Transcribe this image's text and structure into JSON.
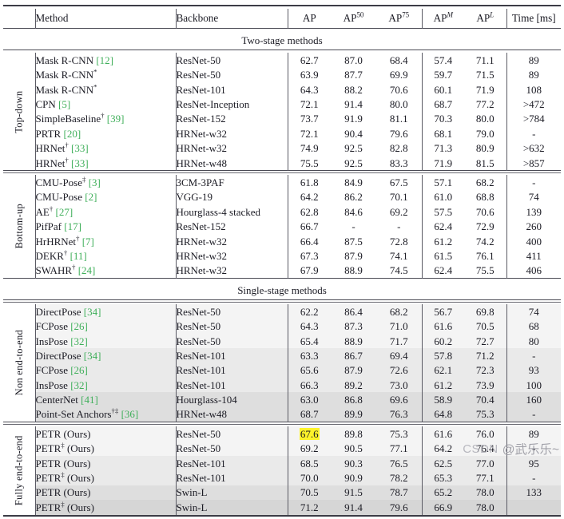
{
  "table": {
    "columns": [
      {
        "key": "group",
        "label": ""
      },
      {
        "key": "method",
        "label": "Method"
      },
      {
        "key": "backbone",
        "label": "Backbone"
      },
      {
        "key": "ap",
        "label": "AP"
      },
      {
        "key": "ap50",
        "label": "AP",
        "sup": "50"
      },
      {
        "key": "ap75",
        "label": "AP",
        "sup": "75"
      },
      {
        "key": "apm",
        "label": "AP",
        "sup": "M",
        "sup_italic": true
      },
      {
        "key": "apl",
        "label": "AP",
        "sup": "L",
        "sup_italic": true
      },
      {
        "key": "time",
        "label": "Time [ms]"
      }
    ],
    "banners": {
      "two_stage": "Two-stage methods",
      "single_stage": "Single-stage methods"
    },
    "groups": [
      {
        "label": "Top-down",
        "rows": [
          {
            "method": "Mask R-CNN",
            "cite": "12",
            "sup": "",
            "backbone": "ResNet-50",
            "ap": "62.7",
            "ap50": "87.0",
            "ap75": "68.4",
            "apm": "57.4",
            "apl": "71.1",
            "time": "89",
            "shade": "sh0"
          },
          {
            "method": "Mask R-CNN",
            "cite": "",
            "sup": "*",
            "backbone": "ResNet-50",
            "ap": "63.9",
            "ap50": "87.7",
            "ap75": "69.9",
            "apm": "59.7",
            "apl": "71.5",
            "time": "89",
            "shade": "sh0"
          },
          {
            "method": "Mask R-CNN",
            "cite": "",
            "sup": "*",
            "backbone": "ResNet-101",
            "ap": "64.3",
            "ap50": "88.2",
            "ap75": "70.6",
            "apm": "60.1",
            "apl": "71.9",
            "time": "108",
            "shade": "sh0"
          },
          {
            "method": "CPN",
            "cite": "5",
            "sup": "",
            "backbone": "ResNet-Inception",
            "ap": "72.1",
            "ap50": "91.4",
            "ap75": "80.0",
            "apm": "68.7",
            "apl": "77.2",
            "time": ">472",
            "shade": "sh0"
          },
          {
            "method": "SimpleBaseline",
            "cite": "39",
            "sup": "†",
            "backbone": "ResNet-152",
            "ap": "73.7",
            "ap50": "91.9",
            "ap75": "81.1",
            "apm": "70.3",
            "apl": "80.0",
            "time": ">784",
            "shade": "sh0"
          },
          {
            "method": "PRTR",
            "cite": "20",
            "sup": "",
            "backbone": "HRNet-w32",
            "ap": "72.1",
            "ap50": "90.4",
            "ap75": "79.6",
            "apm": "68.1",
            "apl": "79.0",
            "time": "-",
            "shade": "sh0"
          },
          {
            "method": "HRNet",
            "cite": "33",
            "sup": "†",
            "backbone": "HRNet-w32",
            "ap": "74.9",
            "ap50": "92.5",
            "ap75": "82.8",
            "apm": "71.3",
            "apl": "80.9",
            "time": ">632",
            "shade": "sh0"
          },
          {
            "method": "HRNet",
            "cite": "33",
            "sup": "†",
            "backbone": "HRNet-w48",
            "ap": "75.5",
            "ap50": "92.5",
            "ap75": "83.3",
            "apm": "71.9",
            "apl": "81.5",
            "time": ">857",
            "shade": "sh0"
          }
        ]
      },
      {
        "label": "Bottom-up",
        "rows": [
          {
            "method": "CMU-Pose",
            "cite": "3",
            "sup": "‡",
            "backbone": "3CM-3PAF",
            "ap": "61.8",
            "ap50": "84.9",
            "ap75": "67.5",
            "apm": "57.1",
            "apl": "68.2",
            "time": "-",
            "shade": "sh0"
          },
          {
            "method": "CMU-Pose",
            "cite": "2",
            "sup": "",
            "backbone": "VGG-19",
            "ap": "64.2",
            "ap50": "86.2",
            "ap75": "70.1",
            "apm": "61.0",
            "apl": "68.8",
            "time": "74",
            "shade": "sh0"
          },
          {
            "method": "AE",
            "cite": "27",
            "sup": "†",
            "backbone": "Hourglass-4 stacked",
            "ap": "62.8",
            "ap50": "84.6",
            "ap75": "69.2",
            "apm": "57.5",
            "apl": "70.6",
            "time": "139",
            "shade": "sh0"
          },
          {
            "method": "PifPaf",
            "cite": "17",
            "sup": "",
            "backbone": "ResNet-152",
            "ap": "66.7",
            "ap50": "-",
            "ap75": "-",
            "apm": "62.4",
            "apl": "72.9",
            "time": "260",
            "shade": "sh0"
          },
          {
            "method": "HrHRNet",
            "cite": "7",
            "sup": "†",
            "backbone": "HRNet-w32",
            "ap": "66.4",
            "ap50": "87.5",
            "ap75": "72.8",
            "apm": "61.2",
            "apl": "74.2",
            "time": "400",
            "shade": "sh0"
          },
          {
            "method": "DEKR",
            "cite": "11",
            "sup": "†",
            "backbone": "HRNet-w32",
            "ap": "67.3",
            "ap50": "87.9",
            "ap75": "74.1",
            "apm": "61.5",
            "apl": "76.1",
            "time": "411",
            "shade": "sh0"
          },
          {
            "method": "SWAHR",
            "cite": "24",
            "sup": "†",
            "backbone": "HRNet-w32",
            "ap": "67.9",
            "ap50": "88.9",
            "ap75": "74.5",
            "apm": "62.4",
            "apl": "75.5",
            "time": "406",
            "shade": "sh0"
          }
        ]
      },
      {
        "label": "Non end-to-end",
        "rows": [
          {
            "method": "DirectPose",
            "cite": "34",
            "sup": "",
            "backbone": "ResNet-50",
            "ap": "62.2",
            "ap50": "86.4",
            "ap75": "68.2",
            "apm": "56.7",
            "apl": "69.8",
            "time": "74",
            "shade": "sh1"
          },
          {
            "method": "FCPose",
            "cite": "26",
            "sup": "",
            "backbone": "ResNet-50",
            "ap": "64.3",
            "ap50": "87.3",
            "ap75": "71.0",
            "apm": "61.6",
            "apl": "70.5",
            "time": "68",
            "shade": "sh1"
          },
          {
            "method": "InsPose",
            "cite": "32",
            "sup": "",
            "backbone": "ResNet-50",
            "ap": "65.4",
            "ap50": "88.9",
            "ap75": "71.7",
            "apm": "60.2",
            "apl": "72.7",
            "time": "80",
            "shade": "sh1"
          },
          {
            "method": "DirectPose",
            "cite": "34",
            "sup": "",
            "backbone": "ResNet-101",
            "ap": "63.3",
            "ap50": "86.7",
            "ap75": "69.4",
            "apm": "57.8",
            "apl": "71.2",
            "time": "-",
            "shade": "sh2"
          },
          {
            "method": "FCPose",
            "cite": "26",
            "sup": "",
            "backbone": "ResNet-101",
            "ap": "65.6",
            "ap50": "87.9",
            "ap75": "72.6",
            "apm": "62.1",
            "apl": "72.3",
            "time": "93",
            "shade": "sh2"
          },
          {
            "method": "InsPose",
            "cite": "32",
            "sup": "",
            "backbone": "ResNet-101",
            "ap": "66.3",
            "ap50": "89.2",
            "ap75": "73.0",
            "apm": "61.2",
            "apl": "73.9",
            "time": "100",
            "shade": "sh2"
          },
          {
            "method": "CenterNet",
            "cite": "41",
            "sup": "",
            "backbone": "Hourglass-104",
            "ap": "63.0",
            "ap50": "86.8",
            "ap75": "69.6",
            "apm": "58.9",
            "apl": "70.4",
            "time": "160",
            "shade": "sh3"
          },
          {
            "method": "Point-Set Anchors",
            "cite": "36",
            "sup": "†‡",
            "backbone": "HRNet-w48",
            "ap": "68.7",
            "ap50": "89.9",
            "ap75": "76.3",
            "apm": "64.8",
            "apl": "75.3",
            "time": "-",
            "shade": "sh3"
          }
        ]
      },
      {
        "label": "Fully end-to-end",
        "rows": [
          {
            "method": "PETR (Ours)",
            "cite": "",
            "sup": "",
            "backbone": "ResNet-50",
            "ap": "67.6",
            "ap_highlight": true,
            "ap50": "89.8",
            "ap75": "75.3",
            "apm": "61.6",
            "apl": "76.0",
            "time": "89",
            "shade": "sh1"
          },
          {
            "method": "PETR",
            "cite": "",
            "sup": "‡",
            "suffix": " (Ours)",
            "backbone": "ResNet-50",
            "ap": "69.2",
            "ap50": "90.5",
            "ap75": "77.1",
            "apm": "64.2",
            "apl": "76.4",
            "time": "-",
            "shade": "sh1"
          },
          {
            "method": "PETR (Ours)",
            "cite": "",
            "sup": "",
            "backbone": "ResNet-101",
            "ap": "68.5",
            "ap50": "90.3",
            "ap75": "76.5",
            "apm": "62.5",
            "apl": "77.0",
            "time": "95",
            "shade": "sh2"
          },
          {
            "method": "PETR",
            "cite": "",
            "sup": "‡",
            "suffix": " (Ours)",
            "backbone": "ResNet-101",
            "ap": "70.0",
            "ap50": "90.9",
            "ap75": "78.2",
            "apm": "65.3",
            "apl": "77.1",
            "time": "-",
            "shade": "sh2"
          },
          {
            "method": "PETR (Ours)",
            "cite": "",
            "sup": "",
            "backbone": "Swin-L",
            "ap": "70.5",
            "ap50": "91.5",
            "ap75": "78.7",
            "apm": "65.2",
            "apl": "78.0",
            "time": "133",
            "shade": "sh3"
          },
          {
            "method": "PETR",
            "cite": "",
            "sup": "‡",
            "suffix": " (Ours)",
            "backbone": "Swin-L",
            "ap": "71.2",
            "ap50": "91.4",
            "ap75": "79.6",
            "apm": "66.9",
            "apl": "78.0",
            "time": "",
            "shade": "sh4"
          }
        ]
      }
    ]
  },
  "watermark": {
    "brand": "CSDN",
    "user": "@武乐乐~"
  },
  "colors": {
    "citation": "#3faf5a",
    "highlight": "#fdf32a",
    "rule": "#3c3c46",
    "text": "#1b1b24"
  }
}
